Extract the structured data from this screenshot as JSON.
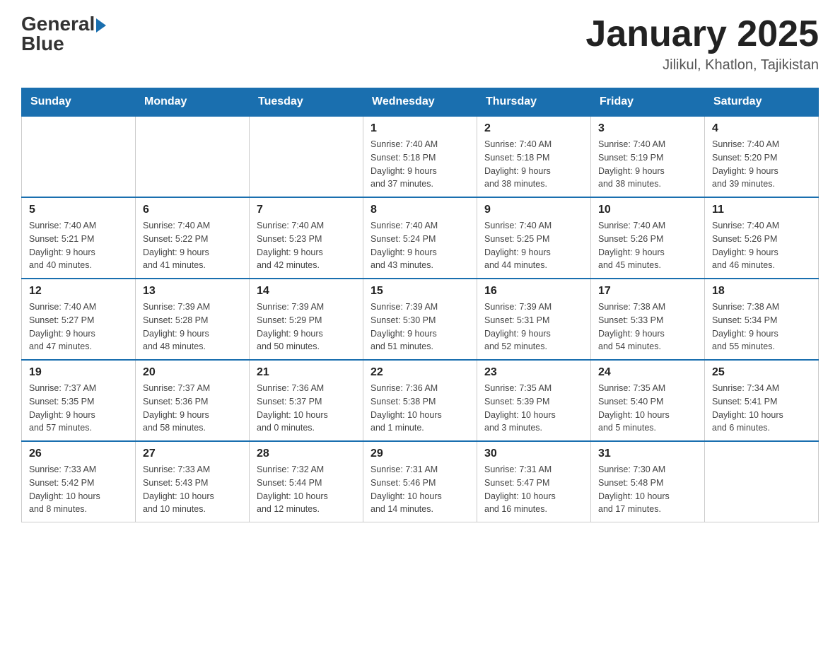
{
  "header": {
    "logo_text_general": "General",
    "logo_text_blue": "Blue",
    "title": "January 2025",
    "subtitle": "Jilikul, Khatlon, Tajikistan"
  },
  "calendar": {
    "days_of_week": [
      "Sunday",
      "Monday",
      "Tuesday",
      "Wednesday",
      "Thursday",
      "Friday",
      "Saturday"
    ],
    "weeks": [
      [
        {
          "day": "",
          "info": ""
        },
        {
          "day": "",
          "info": ""
        },
        {
          "day": "",
          "info": ""
        },
        {
          "day": "1",
          "info": "Sunrise: 7:40 AM\nSunset: 5:18 PM\nDaylight: 9 hours\nand 37 minutes."
        },
        {
          "day": "2",
          "info": "Sunrise: 7:40 AM\nSunset: 5:18 PM\nDaylight: 9 hours\nand 38 minutes."
        },
        {
          "day": "3",
          "info": "Sunrise: 7:40 AM\nSunset: 5:19 PM\nDaylight: 9 hours\nand 38 minutes."
        },
        {
          "day": "4",
          "info": "Sunrise: 7:40 AM\nSunset: 5:20 PM\nDaylight: 9 hours\nand 39 minutes."
        }
      ],
      [
        {
          "day": "5",
          "info": "Sunrise: 7:40 AM\nSunset: 5:21 PM\nDaylight: 9 hours\nand 40 minutes."
        },
        {
          "day": "6",
          "info": "Sunrise: 7:40 AM\nSunset: 5:22 PM\nDaylight: 9 hours\nand 41 minutes."
        },
        {
          "day": "7",
          "info": "Sunrise: 7:40 AM\nSunset: 5:23 PM\nDaylight: 9 hours\nand 42 minutes."
        },
        {
          "day": "8",
          "info": "Sunrise: 7:40 AM\nSunset: 5:24 PM\nDaylight: 9 hours\nand 43 minutes."
        },
        {
          "day": "9",
          "info": "Sunrise: 7:40 AM\nSunset: 5:25 PM\nDaylight: 9 hours\nand 44 minutes."
        },
        {
          "day": "10",
          "info": "Sunrise: 7:40 AM\nSunset: 5:26 PM\nDaylight: 9 hours\nand 45 minutes."
        },
        {
          "day": "11",
          "info": "Sunrise: 7:40 AM\nSunset: 5:26 PM\nDaylight: 9 hours\nand 46 minutes."
        }
      ],
      [
        {
          "day": "12",
          "info": "Sunrise: 7:40 AM\nSunset: 5:27 PM\nDaylight: 9 hours\nand 47 minutes."
        },
        {
          "day": "13",
          "info": "Sunrise: 7:39 AM\nSunset: 5:28 PM\nDaylight: 9 hours\nand 48 minutes."
        },
        {
          "day": "14",
          "info": "Sunrise: 7:39 AM\nSunset: 5:29 PM\nDaylight: 9 hours\nand 50 minutes."
        },
        {
          "day": "15",
          "info": "Sunrise: 7:39 AM\nSunset: 5:30 PM\nDaylight: 9 hours\nand 51 minutes."
        },
        {
          "day": "16",
          "info": "Sunrise: 7:39 AM\nSunset: 5:31 PM\nDaylight: 9 hours\nand 52 minutes."
        },
        {
          "day": "17",
          "info": "Sunrise: 7:38 AM\nSunset: 5:33 PM\nDaylight: 9 hours\nand 54 minutes."
        },
        {
          "day": "18",
          "info": "Sunrise: 7:38 AM\nSunset: 5:34 PM\nDaylight: 9 hours\nand 55 minutes."
        }
      ],
      [
        {
          "day": "19",
          "info": "Sunrise: 7:37 AM\nSunset: 5:35 PM\nDaylight: 9 hours\nand 57 minutes."
        },
        {
          "day": "20",
          "info": "Sunrise: 7:37 AM\nSunset: 5:36 PM\nDaylight: 9 hours\nand 58 minutes."
        },
        {
          "day": "21",
          "info": "Sunrise: 7:36 AM\nSunset: 5:37 PM\nDaylight: 10 hours\nand 0 minutes."
        },
        {
          "day": "22",
          "info": "Sunrise: 7:36 AM\nSunset: 5:38 PM\nDaylight: 10 hours\nand 1 minute."
        },
        {
          "day": "23",
          "info": "Sunrise: 7:35 AM\nSunset: 5:39 PM\nDaylight: 10 hours\nand 3 minutes."
        },
        {
          "day": "24",
          "info": "Sunrise: 7:35 AM\nSunset: 5:40 PM\nDaylight: 10 hours\nand 5 minutes."
        },
        {
          "day": "25",
          "info": "Sunrise: 7:34 AM\nSunset: 5:41 PM\nDaylight: 10 hours\nand 6 minutes."
        }
      ],
      [
        {
          "day": "26",
          "info": "Sunrise: 7:33 AM\nSunset: 5:42 PM\nDaylight: 10 hours\nand 8 minutes."
        },
        {
          "day": "27",
          "info": "Sunrise: 7:33 AM\nSunset: 5:43 PM\nDaylight: 10 hours\nand 10 minutes."
        },
        {
          "day": "28",
          "info": "Sunrise: 7:32 AM\nSunset: 5:44 PM\nDaylight: 10 hours\nand 12 minutes."
        },
        {
          "day": "29",
          "info": "Sunrise: 7:31 AM\nSunset: 5:46 PM\nDaylight: 10 hours\nand 14 minutes."
        },
        {
          "day": "30",
          "info": "Sunrise: 7:31 AM\nSunset: 5:47 PM\nDaylight: 10 hours\nand 16 minutes."
        },
        {
          "day": "31",
          "info": "Sunrise: 7:30 AM\nSunset: 5:48 PM\nDaylight: 10 hours\nand 17 minutes."
        },
        {
          "day": "",
          "info": ""
        }
      ]
    ]
  }
}
